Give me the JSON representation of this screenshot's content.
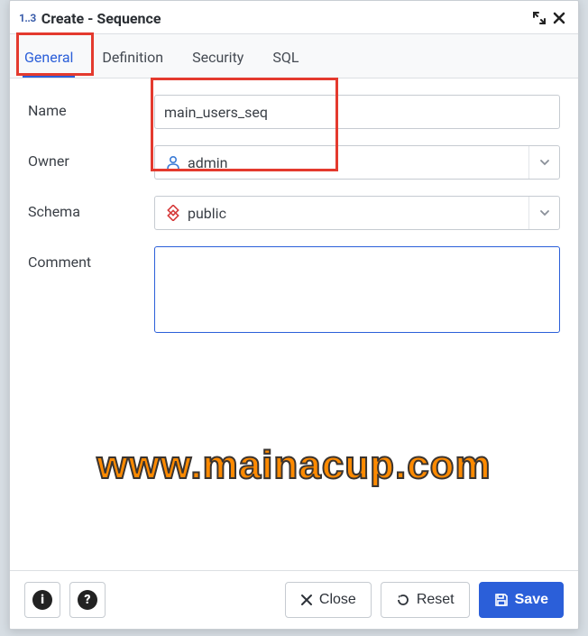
{
  "header": {
    "prefix": "1..3",
    "title": "Create - Sequence"
  },
  "tabs": [
    {
      "label": "General",
      "active": true
    },
    {
      "label": "Definition",
      "active": false
    },
    {
      "label": "Security",
      "active": false
    },
    {
      "label": "SQL",
      "active": false
    }
  ],
  "form": {
    "name_label": "Name",
    "name_value": "main_users_seq",
    "owner_label": "Owner",
    "owner_value": "admin",
    "schema_label": "Schema",
    "schema_value": "public",
    "comment_label": "Comment",
    "comment_value": ""
  },
  "footer": {
    "close_label": "Close",
    "reset_label": "Reset",
    "save_label": "Save"
  },
  "watermark": "www.mainacup.com"
}
